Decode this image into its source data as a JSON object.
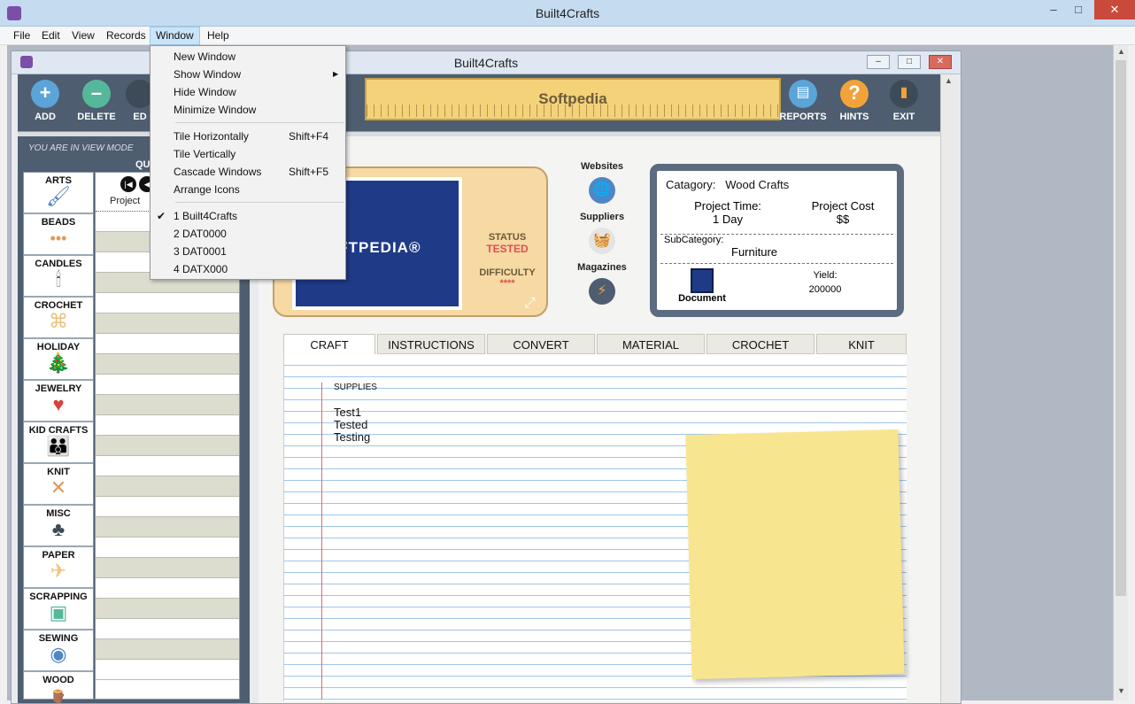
{
  "app": {
    "title": "Built4Crafts",
    "inner_title": "Built4Crafts"
  },
  "window_controls": {
    "minimize": "–",
    "maximize": "□",
    "close": "✕"
  },
  "menubar": [
    "File",
    "Edit",
    "View",
    "Records",
    "Window",
    "Help"
  ],
  "window_menu": {
    "items": [
      {
        "label": "New Window",
        "shortcut": ""
      },
      {
        "label": "Show Window",
        "shortcut": ""
      },
      {
        "label": "Hide Window",
        "shortcut": ""
      },
      {
        "label": "Minimize Window",
        "shortcut": ""
      },
      {
        "label": "Tile Horizontally",
        "shortcut": "Shift+F4"
      },
      {
        "label": "Tile Vertically",
        "shortcut": ""
      },
      {
        "label": "Cascade Windows",
        "shortcut": "Shift+F5"
      },
      {
        "label": "Arrange Icons",
        "shortcut": ""
      },
      {
        "label": "1 Built4Crafts",
        "shortcut": ""
      },
      {
        "label": "2 DAT0000",
        "shortcut": ""
      },
      {
        "label": "3 DAT0001",
        "shortcut": ""
      },
      {
        "label": "4 DATX000",
        "shortcut": ""
      }
    ],
    "checked_mark": "✔",
    "submenu_arrow": "▶"
  },
  "toolbar": {
    "add": "ADD",
    "delete": "DELETE",
    "edit": "ED",
    "banner": "Softpedia",
    "reports": "REPORTS",
    "hints": "HINTS",
    "exit": "EXIT",
    "add_glyph": "+",
    "delete_glyph": "–",
    "hints_glyph": "?"
  },
  "view_mode": "YOU ARE IN VIEW MODE",
  "quick_label": "QU",
  "categories": [
    {
      "name": "ARTS",
      "icon": "🖌"
    },
    {
      "name": "BEADS",
      "icon": "•••"
    },
    {
      "name": "CANDLES",
      "icon": "🕯"
    },
    {
      "name": "CROCHET",
      "icon": "⌘"
    },
    {
      "name": "HOLIDAY",
      "icon": "🎄"
    },
    {
      "name": "JEWELRY",
      "icon": "♥"
    },
    {
      "name": "KID CRAFTS",
      "icon": "👪"
    },
    {
      "name": "KNIT",
      "icon": "✕"
    },
    {
      "name": "MISC",
      "icon": "♣"
    },
    {
      "name": "PAPER",
      "icon": "✈"
    },
    {
      "name": "SCRAPPING",
      "icon": "▣"
    },
    {
      "name": "SEWING",
      "icon": "◉"
    },
    {
      "name": "WOOD",
      "icon": "🪵"
    }
  ],
  "grid": {
    "header": "Project",
    "nav": [
      "|◀",
      "◀"
    ]
  },
  "card": {
    "photo_text": "OFTPEDIA®",
    "status_label": "STATUS",
    "status_value": "TESTED",
    "difficulty_label": "DIFFICULTY",
    "difficulty_value": "****",
    "expand_glyph": "⤢"
  },
  "links": [
    {
      "label": "Websites",
      "icon": "🌐",
      "color": "#4f86c6"
    },
    {
      "label": "Suppliers",
      "icon": "🧺",
      "color": "#e0e0e0"
    },
    {
      "label": "Magazines",
      "icon": "⚡",
      "color": "#4e5d70"
    }
  ],
  "info": {
    "category_label": "Catagory:",
    "category_value": "Wood Crafts",
    "time_label": "Project Time:",
    "time_value": "1 Day",
    "cost_label": "Project Cost",
    "cost_value": "$$",
    "subcat_label": "SubCategory:",
    "subcat_value": "Furniture",
    "document_label": "Document",
    "yield_label": "Yield:",
    "yield_value": "200000"
  },
  "tabs": [
    "CRAFT",
    "INSTRUCTIONS",
    "CONVERT",
    "MATERIAL",
    "CROCHET",
    "KNIT"
  ],
  "supplies": {
    "header": "SUPPLIES",
    "items": [
      "Test1",
      "Tested",
      "Testing"
    ]
  },
  "colors": {
    "status": "#e05050",
    "toolbar": "#4e5d70",
    "accent": "#f6d9a3"
  }
}
